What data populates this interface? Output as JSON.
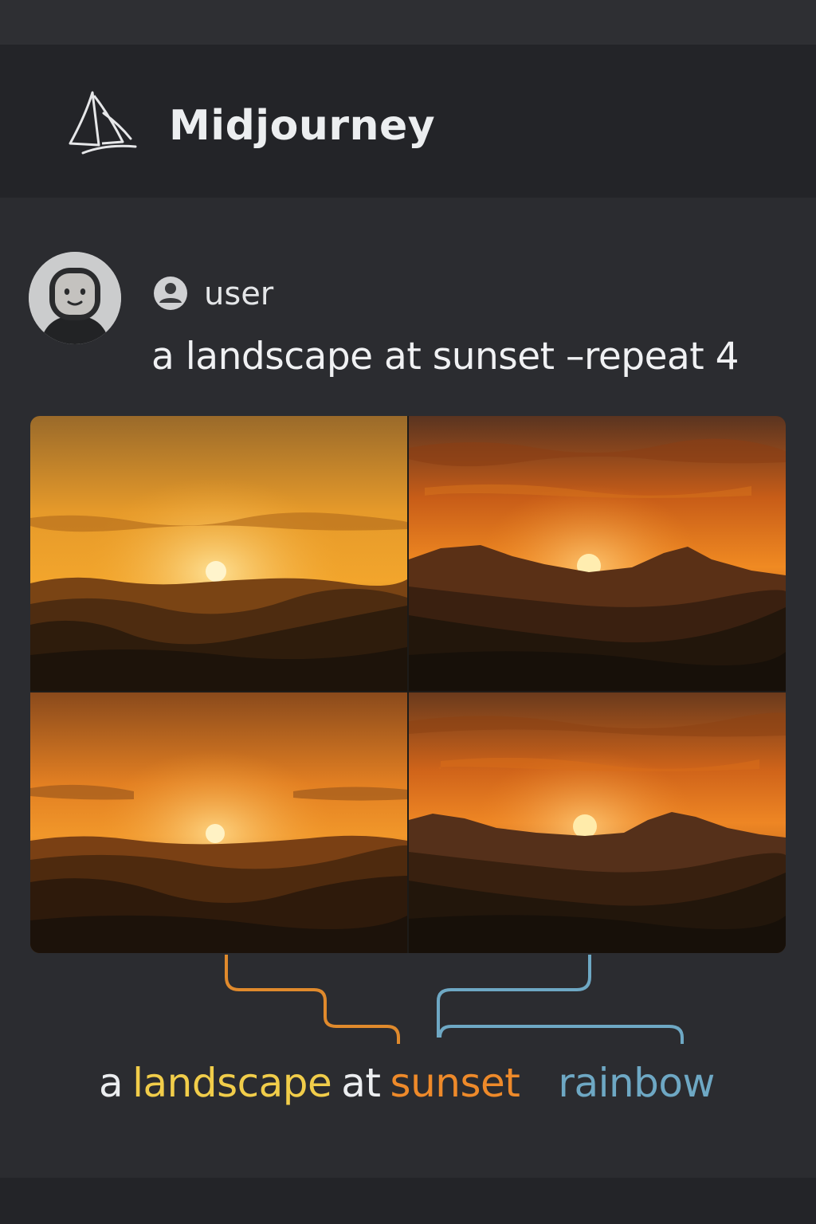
{
  "header": {
    "app_title": "Midjourney",
    "logo_icon": "sailboat-icon"
  },
  "message": {
    "avatar_icon": "robot-avatar-icon",
    "user_icon": "user-icon",
    "username": "user",
    "prompt": "a landscape at sunset –repeat 4"
  },
  "image_grid": {
    "tiles": [
      "sunset-landscape-1",
      "sunset-landscape-2",
      "sunset-landscape-3",
      "sunset-landscape-4"
    ]
  },
  "caption": {
    "word_a": "a",
    "word_landscape": "landscape",
    "word_at": "at",
    "word_sunset": "sunset",
    "word_rainbow": "rainbow"
  },
  "colors": {
    "background": "#2b2c30",
    "header": "#232428",
    "landscape_highlight": "#f1cd4a",
    "sunset_highlight": "#ee8a2a",
    "rainbow_highlight": "#6ea8c4"
  }
}
